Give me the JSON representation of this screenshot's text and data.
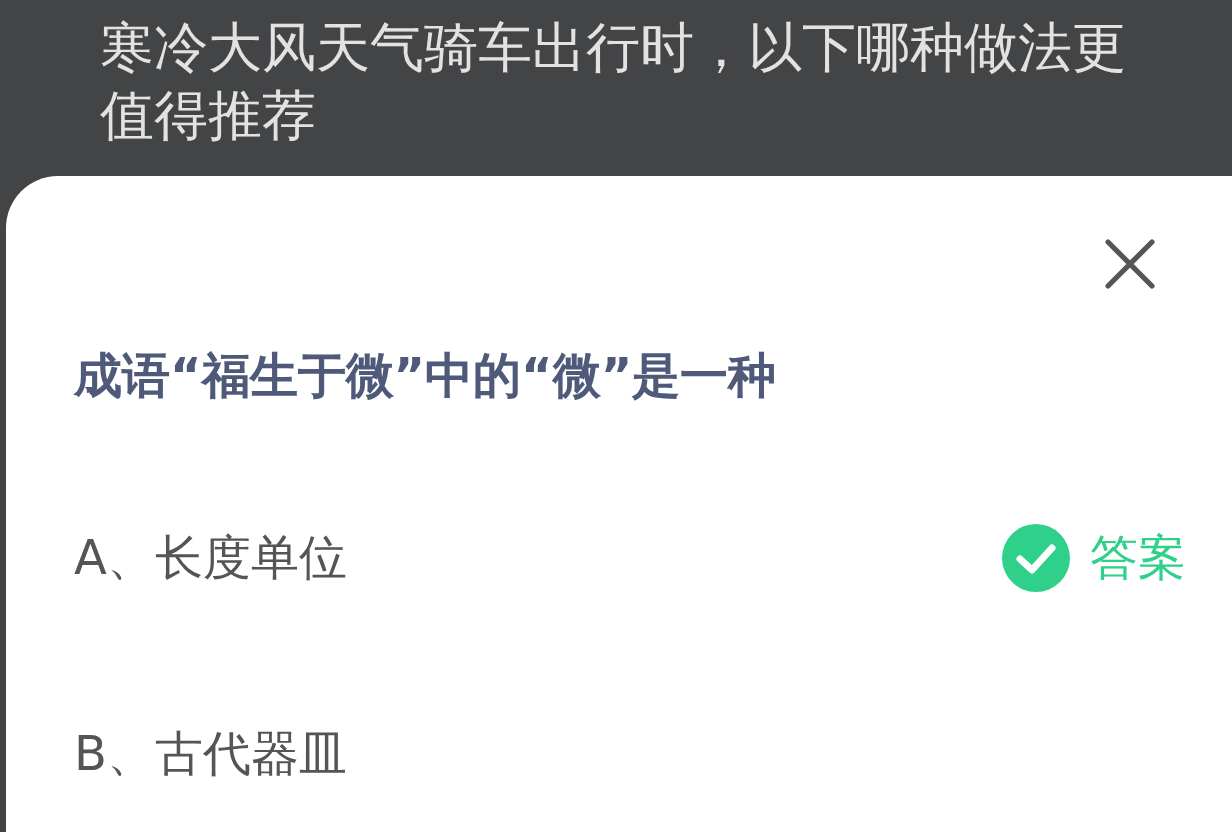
{
  "background_question": "寒冷大风天气骑车出行时，以下哪种做法更值得推荐",
  "dialog": {
    "question": "成语“福生于微”中的“微”是一种",
    "options": [
      {
        "text": "A、长度单位",
        "correct": true,
        "badge": "答案"
      },
      {
        "text": "B、古代器皿",
        "correct": false
      }
    ]
  }
}
